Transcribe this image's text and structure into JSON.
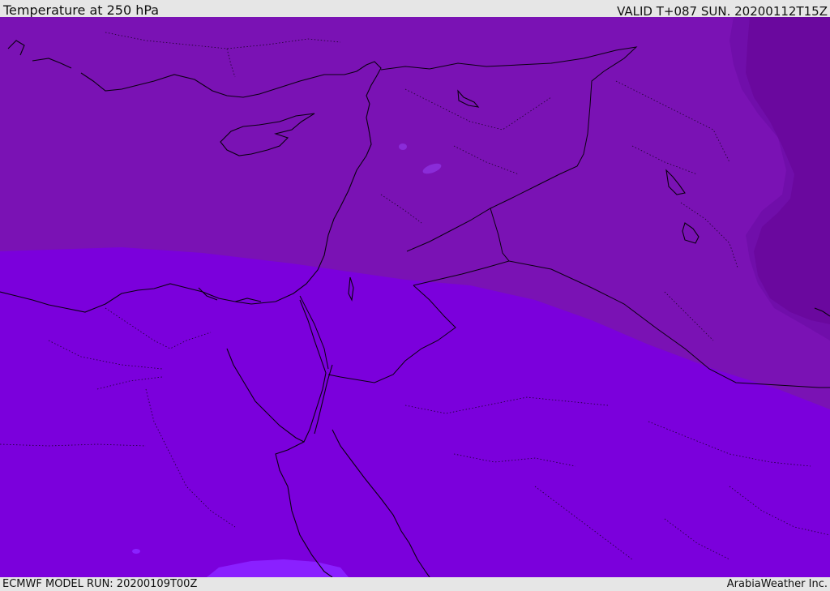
{
  "header": {
    "title": "Temperature at 250 hPa",
    "valid": "VALID T+087 SUN. 20200112T15Z"
  },
  "footer": {
    "model_run": "ECMWF MODEL RUN: 20200109T00Z",
    "credit": "ArabiaWeather Inc."
  },
  "colors": {
    "band_north": "#7a12b4",
    "band_south": "#7b00dc",
    "band_east_dark": "#6a0aa0",
    "band_east_mid": "#720fae",
    "small_patch": "#8a22ff",
    "coast": "#0a0010"
  },
  "icons": []
}
